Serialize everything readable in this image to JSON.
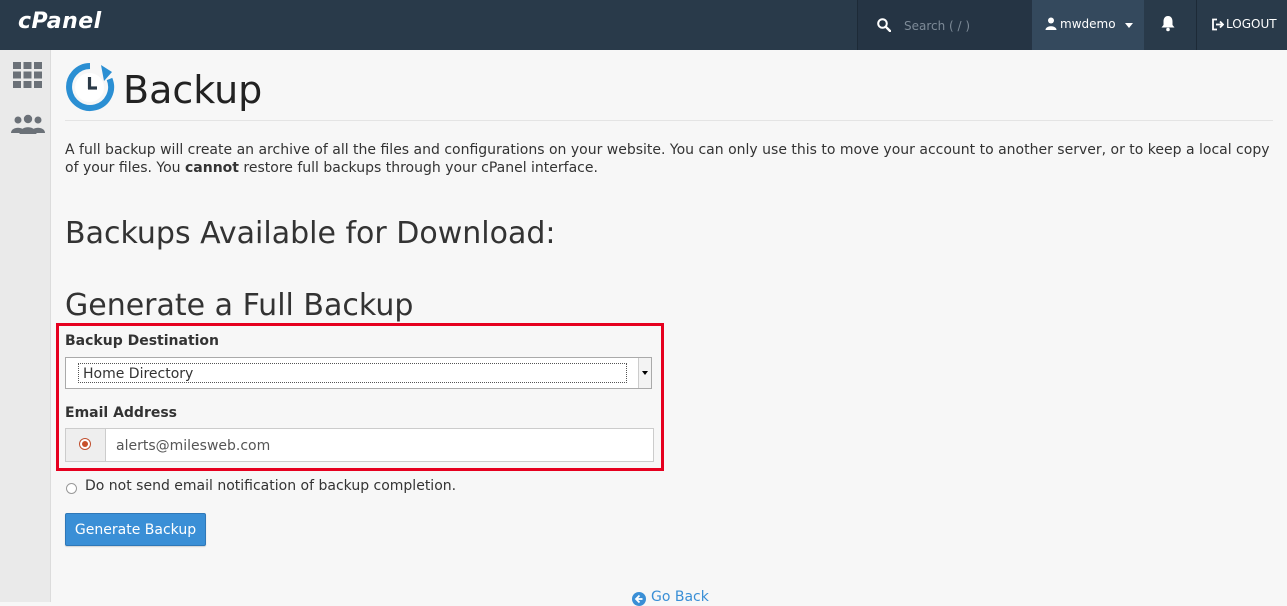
{
  "topbar": {
    "logo": "cPanel",
    "search_placeholder": "Search ( / )",
    "username": "mwdemo",
    "logout_label": "LOGOUT"
  },
  "sidebar": {
    "icons": [
      "grid-icon",
      "users-icon"
    ]
  },
  "page": {
    "title": "Backup",
    "description_part1": "A full backup will create an archive of all the files and configurations on your website. You can only use this to move your account to another server, or to keep a local copy of your files. You ",
    "description_bold": "cannot",
    "description_part2": " restore full backups through your cPanel interface.",
    "heading_available": "Backups Available for Download:",
    "heading_generate": "Generate a Full Backup",
    "destination_label": "Backup Destination",
    "destination_value": "Home Directory",
    "email_label": "Email Address",
    "email_value": "alerts@milesweb.com",
    "no_email_label": "Do not send email notification of backup completion.",
    "generate_button": "Generate Backup",
    "go_back": "Go Back"
  },
  "colors": {
    "topbar": "#293a4a",
    "accent": "#3a8fd6",
    "highlight": "#e6001f"
  }
}
